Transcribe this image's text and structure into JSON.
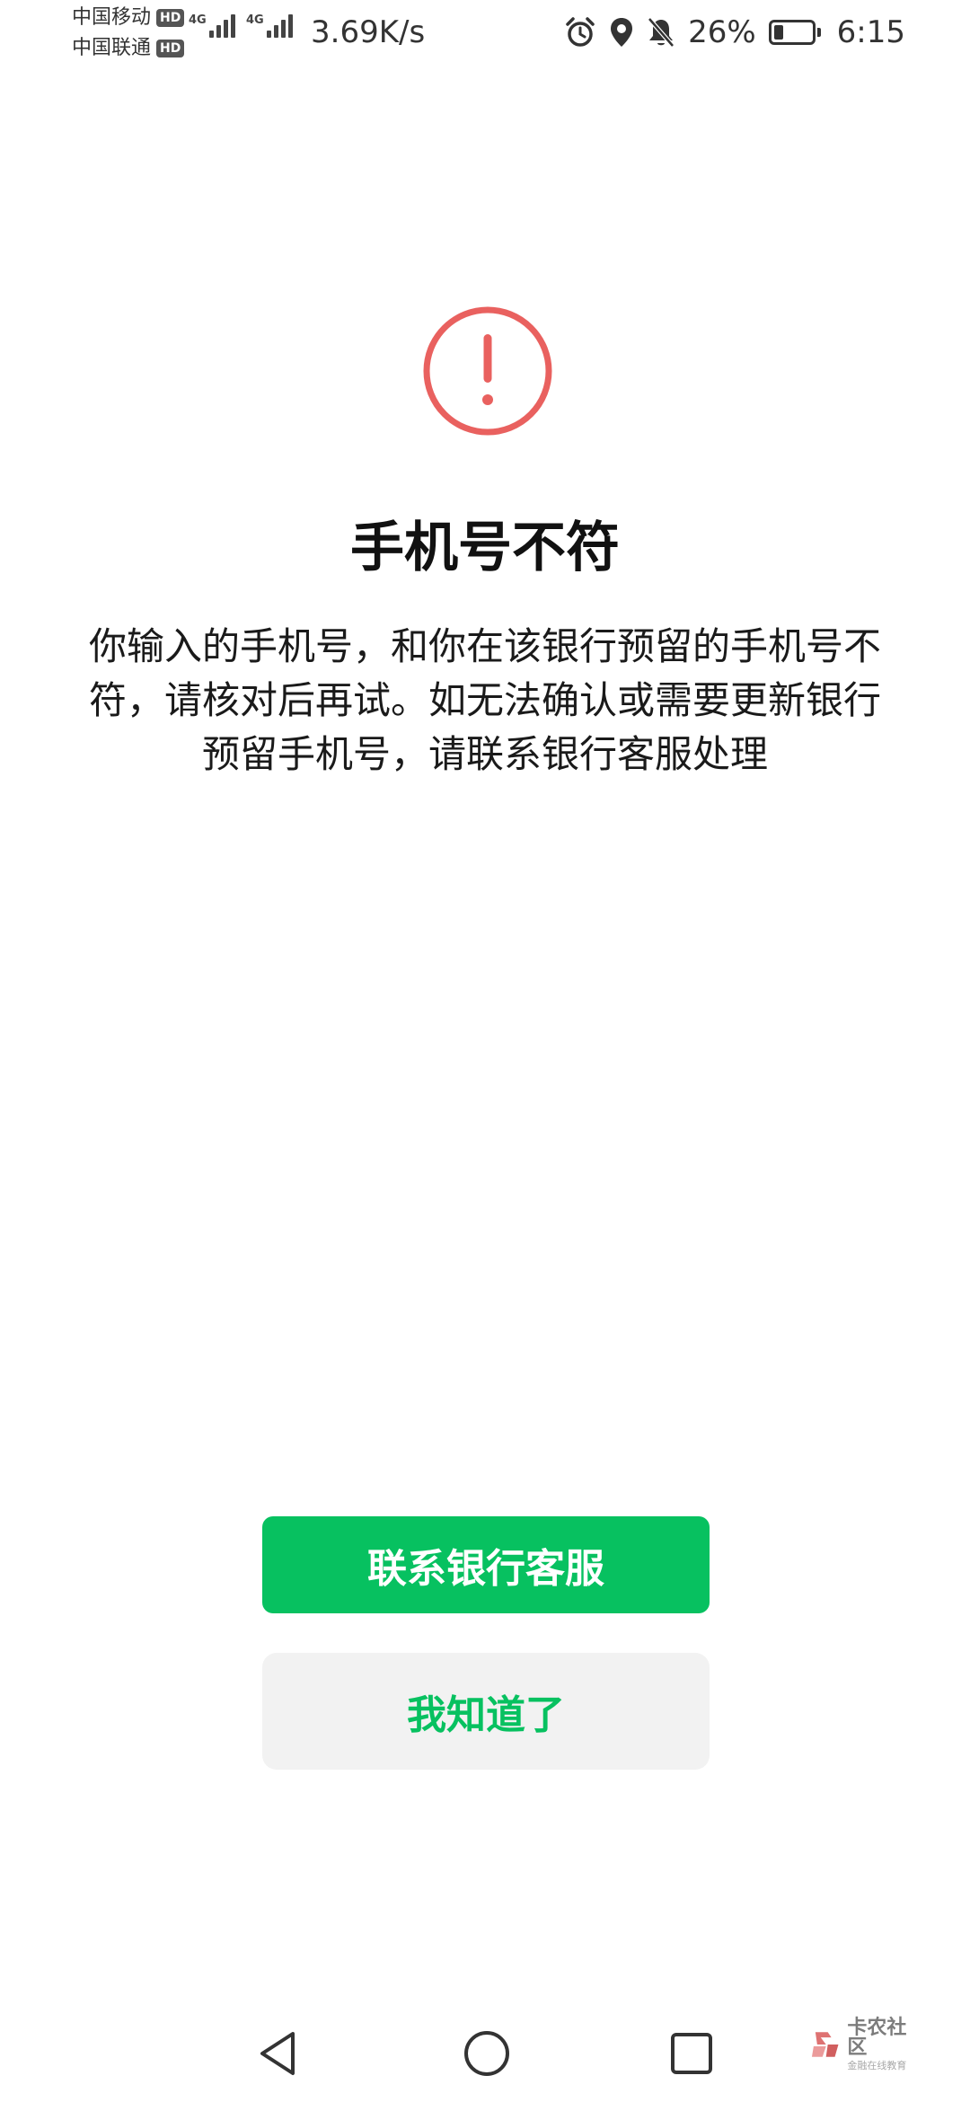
{
  "status_bar": {
    "carrier1": "中国移动",
    "carrier2": "中国联通",
    "hd_badge": "HD",
    "signal1_network": "4G",
    "signal2_network": "4G",
    "net_speed": "3.69K/s",
    "battery_percent": "26%",
    "battery_level": 0.26,
    "time": "6:15",
    "icons": [
      "alarm-icon",
      "location-icon",
      "bell-muted-icon",
      "battery-icon"
    ]
  },
  "dialog": {
    "icon": "alert-circle-icon",
    "icon_color": "#e9615f",
    "title": "手机号不符",
    "message_lines": [
      "你输入的手机号，和你在该银行预留的手机号不",
      "符，请核对后再试。如无法确认或需要更新银行",
      "预留手机号，请联系银行客服处理"
    ]
  },
  "buttons": {
    "primary_label": "联系银行客服",
    "secondary_label": "我知道了",
    "accent_color": "#07c160",
    "secondary_bg": "#f2f2f2"
  },
  "nav_bar": {
    "icons": [
      "back-triangle-icon",
      "home-circle-icon",
      "recents-square-icon"
    ]
  },
  "watermark": {
    "title": "卡农社区",
    "subtitle": "金融在线教育"
  }
}
